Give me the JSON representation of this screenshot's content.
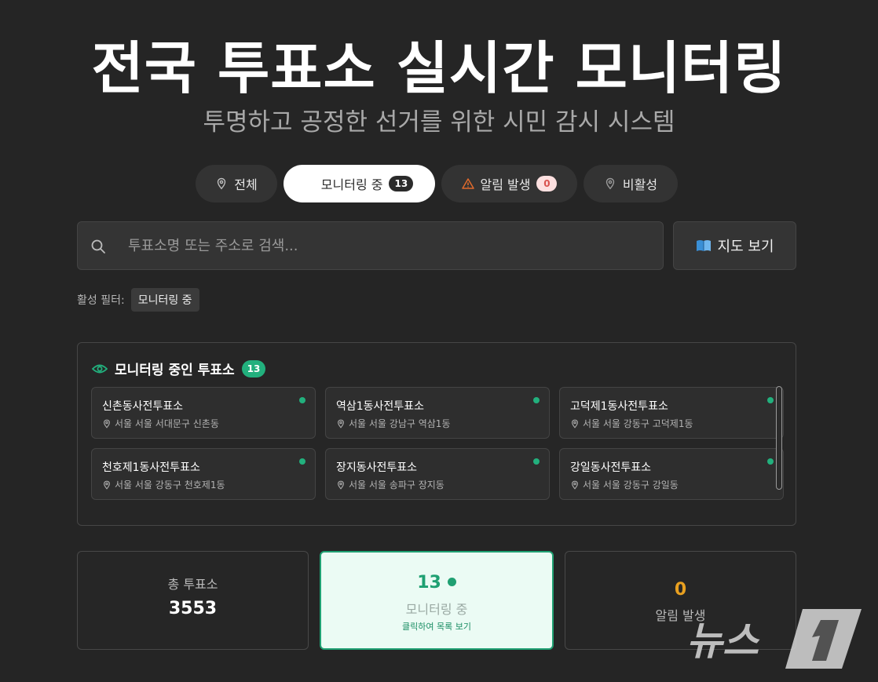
{
  "header": {
    "title": "전국 투표소 실시간 모니터링",
    "subtitle": "투명하고 공정한 선거를 위한 시민 감시 시스템"
  },
  "tabs": [
    {
      "label": "전체",
      "icon": "map-pin-icon"
    },
    {
      "label": "모니터링 중",
      "badge": "13",
      "active": true
    },
    {
      "label": "알림 발생",
      "icon": "warning-icon",
      "badge": "0"
    },
    {
      "label": "비활성",
      "icon": "map-pin-icon"
    }
  ],
  "search": {
    "placeholder": "투표소명 또는 주소로 검색...",
    "value": ""
  },
  "map_button": {
    "label": "지도 보기",
    "icon": "map-icon"
  },
  "filters": {
    "label": "활성 필터:",
    "chips": [
      "모니터링 중"
    ]
  },
  "panel": {
    "title": "모니터링 중인 투표소",
    "count": "13",
    "stations": [
      {
        "name": "신촌동사전투표소",
        "address": "서울 서울 서대문구 신촌동"
      },
      {
        "name": "역삼1동사전투표소",
        "address": "서울 서울 강남구 역삼1동"
      },
      {
        "name": "고덕제1동사전투표소",
        "address": "서울 서울 강동구 고덕제1동"
      },
      {
        "name": "천호제1동사전투표소",
        "address": "서울 서울 강동구 천호제1동"
      },
      {
        "name": "장지동사전투표소",
        "address": "서울 서울 송파구 장지동"
      },
      {
        "name": "강일동사전투표소",
        "address": "서울 서울 강동구 강일동"
      }
    ]
  },
  "stats": {
    "total": {
      "label": "총 투표소",
      "value": "3553"
    },
    "monitoring": {
      "value": "13",
      "label": "모니터링 중",
      "hint": "클릭하여 목록 보기"
    },
    "alerts": {
      "value": "0",
      "label": "알림 발생"
    }
  },
  "watermark": {
    "text": "뉴스1"
  },
  "colors": {
    "background": "#252525",
    "accent_green": "#1fa072",
    "alert_orange": "#e8a020",
    "warning_icon": "#e06a2c"
  }
}
